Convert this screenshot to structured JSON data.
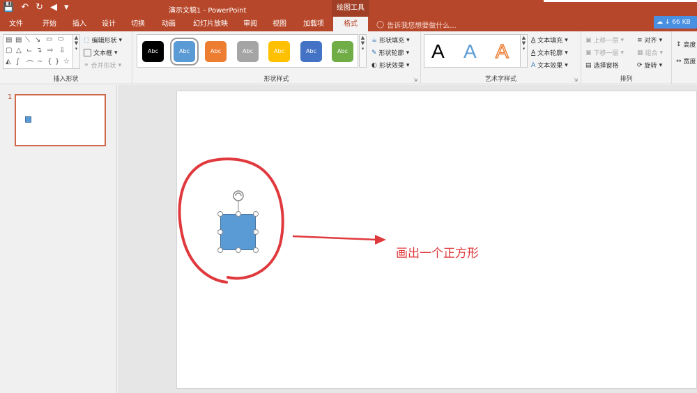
{
  "app": {
    "title": "演示文稿1 - PowerPoint",
    "context_tab_title": "绘图工具"
  },
  "tabs": [
    {
      "label": "文件"
    },
    {
      "label": "开始"
    },
    {
      "label": "插入"
    },
    {
      "label": "设计"
    },
    {
      "label": "切换"
    },
    {
      "label": "动画"
    },
    {
      "label": "幻灯片放映"
    },
    {
      "label": "审阅"
    },
    {
      "label": "视图"
    },
    {
      "label": "加载项"
    },
    {
      "label": "格式"
    }
  ],
  "tell_me": {
    "placeholder": "告诉我您想要做什么..."
  },
  "cloud_badge": {
    "text": "66 KB"
  },
  "ribbon": {
    "insert_shapes": {
      "label": "插入形状",
      "edit_shape": "编辑形状",
      "text_box": "文本框",
      "merge_shapes": "合并形状"
    },
    "shape_styles": {
      "label": "形状样式",
      "swatch_text": "Abc",
      "swatches": [
        {
          "color": "#000000"
        },
        {
          "color": "#5b9bd5",
          "selected": true
        },
        {
          "color": "#ed7d31"
        },
        {
          "color": "#a5a5a5"
        },
        {
          "color": "#ffc000"
        },
        {
          "color": "#4472c4"
        },
        {
          "color": "#70ad47"
        }
      ],
      "fill": "形状填充",
      "outline": "形状轮廓",
      "effects": "形状效果"
    },
    "wordart_styles": {
      "label": "艺术字样式",
      "sample": "A",
      "text_fill": "文本填充",
      "text_outline": "文本轮廓",
      "text_effects": "文本效果"
    },
    "arrange": {
      "label": "排列",
      "bring_forward": "上移一层",
      "send_backward": "下移一层",
      "selection_pane": "选择窗格",
      "align": "对齐",
      "group": "组合",
      "rotate": "旋转"
    },
    "size": {
      "height": "高度",
      "width": "宽度"
    }
  },
  "thumbnails": [
    {
      "number": "1"
    }
  ],
  "annotation": {
    "text": "画出一个正方形",
    "color": "#e0393d"
  },
  "colors": {
    "accent": "#b7472a",
    "shape_fill": "#5b9bd5"
  }
}
